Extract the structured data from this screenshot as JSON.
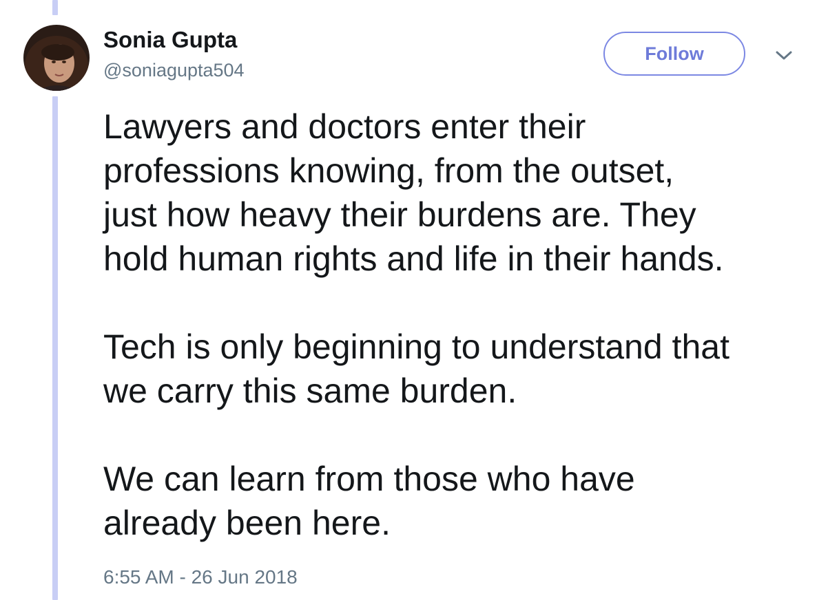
{
  "tweet": {
    "author": {
      "display_name": "Sonia Gupta",
      "handle": "@soniagupta504",
      "avatar_icon": "profile-photo"
    },
    "follow_label": "Follow",
    "menu_icon": "chevron-down-icon",
    "paragraphs": [
      "Lawyers and doctors enter their\nprofessions knowing, from the outset,\njust how heavy their burdens are. They\nhold human rights and life in their hands.",
      "Tech is only beginning to understand that\nwe carry this same burden.",
      "We can learn from those who have\nalready been here."
    ],
    "timestamp": "6:55 AM - 26 Jun 2018"
  },
  "colors": {
    "thread_line": "#c8cef5",
    "follow_accent": "#7b87e3",
    "secondary_text": "#657786",
    "primary_text": "#14171a"
  }
}
